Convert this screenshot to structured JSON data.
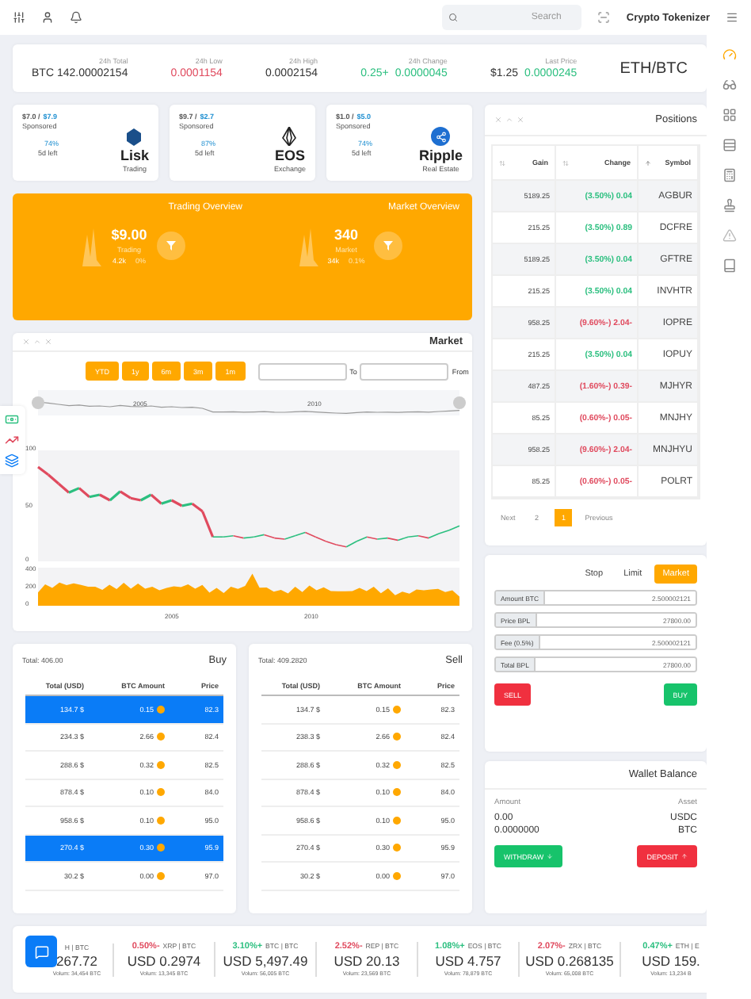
{
  "topbar": {
    "search": {
      "placeholder": "Search"
    },
    "brand": "Crypto Tokenizer"
  },
  "stats": {
    "items": [
      {
        "label": "24h Total",
        "values": [
          {
            "text": "BTC 142.00002154",
            "color": "#333333"
          }
        ]
      },
      {
        "label": "24h Low",
        "values": [
          {
            "text": "0.0001154",
            "color": "#e04a5e"
          }
        ]
      },
      {
        "label": "24h High",
        "values": [
          {
            "text": "0.0002154",
            "color": "#333333"
          }
        ]
      },
      {
        "label": "24h Change",
        "values": [
          {
            "text": "0.25+",
            "color": "#2bbf7f"
          },
          {
            "text": "0.0000045",
            "color": "#2bbf7f"
          }
        ]
      },
      {
        "label": "Last Price",
        "values": [
          {
            "text": "$1.25",
            "color": "#333333"
          },
          {
            "text": "0.0000245",
            "color": "#2bbf7f"
          }
        ]
      }
    ],
    "pair": "ETH/BTC"
  },
  "coins": [
    {
      "price": "$7.0 /",
      "target": "$7.9",
      "note": "Sponsored",
      "percent": "74%",
      "left": "5d left",
      "name": "Lisk",
      "sub": "Trading",
      "kind": "shield"
    },
    {
      "price": "$9.7 /",
      "target": "$2.7",
      "note": "Sponsored",
      "percent": "87%",
      "left": "5d left",
      "name": "EOS",
      "sub": "Exchange",
      "kind": "crystal"
    },
    {
      "price": "$1.0 /",
      "target": "$5.0",
      "note": "Sponsored",
      "percent": "74%",
      "left": "5d left",
      "name": "Ripple",
      "sub": "Real Estate",
      "kind": "share"
    }
  ],
  "overview": [
    {
      "title": "Trading Overview",
      "value": "$9.00",
      "caption": "Trading",
      "stat_a": "4.2k",
      "stat_b": "0%"
    },
    {
      "title": "Market Overview",
      "value": "340",
      "caption": "Market",
      "stat_a": "34k",
      "stat_b": "0.1%"
    }
  ],
  "market": {
    "title": "Market",
    "ranges": [
      {
        "label": "YTD",
        "selected": false
      },
      {
        "label": "1y",
        "selected": false
      },
      {
        "label": "6m",
        "selected": false
      },
      {
        "label": "3m",
        "selected": false
      },
      {
        "label": "1m",
        "selected": false
      }
    ],
    "to_label": "To",
    "from_label": "From",
    "navigator_years": [
      "2005",
      "2010"
    ],
    "price_ticks": [
      "100",
      "50",
      "0"
    ],
    "volume_ticks": [
      "400",
      "200",
      "0"
    ],
    "years": [
      "2005",
      "2010"
    ]
  },
  "positions": {
    "title": "Positions",
    "columns": [
      "Gain",
      "Change",
      "Symbol"
    ],
    "rows": [
      {
        "gain": "5189.25",
        "change": "(3.50%) 0.04",
        "color": "#2bbf7f",
        "symbol": "AGBUR"
      },
      {
        "gain": "215.25",
        "change": "(3.50%) 0.89",
        "color": "#2bbf7f",
        "symbol": "DCFRE"
      },
      {
        "gain": "5189.25",
        "change": "(3.50%) 0.04",
        "color": "#2bbf7f",
        "symbol": "GFTRE"
      },
      {
        "gain": "215.25",
        "change": "(3.50%) 0.04",
        "color": "#2bbf7f",
        "symbol": "INVHTR"
      },
      {
        "gain": "958.25",
        "change": "(9.60%-) 2.04-",
        "color": "#e04a5e",
        "symbol": "IOPRE"
      },
      {
        "gain": "215.25",
        "change": "(3.50%) 0.04",
        "color": "#2bbf7f",
        "symbol": "IOPUY"
      },
      {
        "gain": "487.25",
        "change": "(1.60%-) 0.39-",
        "color": "#e04a5e",
        "symbol": "MJHYR"
      },
      {
        "gain": "85.25",
        "change": "(0.60%-) 0.05-",
        "color": "#e04a5e",
        "symbol": "MNJHY"
      },
      {
        "gain": "958.25",
        "change": "(9.60%-) 2.04-",
        "color": "#e04a5e",
        "symbol": "MNJHYU"
      },
      {
        "gain": "85.25",
        "change": "(0.60%-) 0.05-",
        "color": "#e04a5e",
        "symbol": "POLRT"
      }
    ],
    "pages": [
      {
        "label": "Next",
        "selected": false
      },
      {
        "label": "2",
        "selected": false
      },
      {
        "label": "1",
        "selected": true
      },
      {
        "label": "Previous",
        "selected": false
      }
    ]
  },
  "order": {
    "tabs": [
      {
        "label": "Stop",
        "selected": false
      },
      {
        "label": "Limit",
        "selected": false
      },
      {
        "label": "Market",
        "selected": true
      }
    ],
    "fields": [
      {
        "label": "Amount BTC",
        "value": "2.500002121"
      },
      {
        "label": "Price BPL",
        "value": "27800.00"
      },
      {
        "label": "Fee (0.5%)",
        "value": "2.500002121"
      },
      {
        "label": "Total BPL",
        "value": "27800.00"
      }
    ],
    "sell": "SELL",
    "buy": "BUY"
  },
  "wallet": {
    "title": "Wallet Balance",
    "columns": [
      "Amount",
      "Asset"
    ],
    "rows": [
      {
        "amount": "0.00",
        "asset": "USDC"
      },
      {
        "amount": "0.0000000",
        "asset": "BTC"
      }
    ],
    "withdraw": "WITHDRAW",
    "deposit": "DEPOSIT"
  },
  "books": [
    {
      "side": "Buy",
      "total": "Total: 406.00",
      "columns": [
        "Total (USD)",
        "BTC Amount",
        "Price"
      ],
      "rows": [
        {
          "total": "134.7 $",
          "amount": "0.15",
          "price": "82.3",
          "selected": true
        },
        {
          "total": "234.3 $",
          "amount": "2.66",
          "price": "82.4",
          "selected": false
        },
        {
          "total": "288.6 $",
          "amount": "0.32",
          "price": "82.5",
          "selected": false
        },
        {
          "total": "878.4 $",
          "amount": "0.10",
          "price": "84.0",
          "selected": false
        },
        {
          "total": "958.6 $",
          "amount": "0.10",
          "price": "95.0",
          "selected": false
        },
        {
          "total": "270.4 $",
          "amount": "0.30",
          "price": "95.9",
          "selected": true
        },
        {
          "total": "30.2 $",
          "amount": "0.00",
          "price": "97.0",
          "selected": false
        }
      ]
    },
    {
      "side": "Sell",
      "total": "Total: 409.2820",
      "columns": [
        "Total (USD)",
        "BTC Amount",
        "Price"
      ],
      "rows": [
        {
          "total": "134.7 $",
          "amount": "0.15",
          "price": "82.3",
          "selected": false
        },
        {
          "total": "238.3 $",
          "amount": "2.66",
          "price": "82.4",
          "selected": false
        },
        {
          "total": "288.6 $",
          "amount": "0.32",
          "price": "82.5",
          "selected": false
        },
        {
          "total": "878.4 $",
          "amount": "0.10",
          "price": "84.0",
          "selected": false
        },
        {
          "total": "958.6 $",
          "amount": "0.10",
          "price": "95.0",
          "selected": false
        },
        {
          "total": "270.4 $",
          "amount": "0.30",
          "price": "95.9",
          "selected": false
        },
        {
          "total": "30.2 $",
          "amount": "0.00",
          "price": "97.0",
          "selected": false
        }
      ]
    }
  ],
  "ticker": [
    {
      "pair": "H | BTC",
      "price": "267.72",
      "volume": "Volum: 34,454 BTC"
    },
    {
      "change": "0.50%-",
      "color": "#e04a5e",
      "pair": "XRP | BTC",
      "price": "USD 0.2974",
      "volume": "Volum: 13,345 BTC"
    },
    {
      "change": "3.10%+",
      "color": "#2bbf7f",
      "pair": "BTC | BTC",
      "price": "USD 5,497.49",
      "volume": "Volum: 56,005 BTC"
    },
    {
      "change": "2.52%-",
      "color": "#e04a5e",
      "pair": "REP | BTC",
      "price": "USD 20.13",
      "volume": "Volum: 23,569 BTC"
    },
    {
      "change": "1.08%+",
      "color": "#2bbf7f",
      "pair": "EOS | BTC",
      "price": "USD 4.757",
      "volume": "Volum: 78,879 BTC"
    },
    {
      "change": "2.07%-",
      "color": "#e04a5e",
      "pair": "ZRX | BTC",
      "price": "USD 0.268135",
      "volume": "Volum: 65,008 BTC"
    },
    {
      "change": "0.47%+",
      "color": "#2bbf7f",
      "pair": "ETH | E",
      "price": "USD 159.",
      "volume": "Volum: 13,234 B"
    }
  ]
}
